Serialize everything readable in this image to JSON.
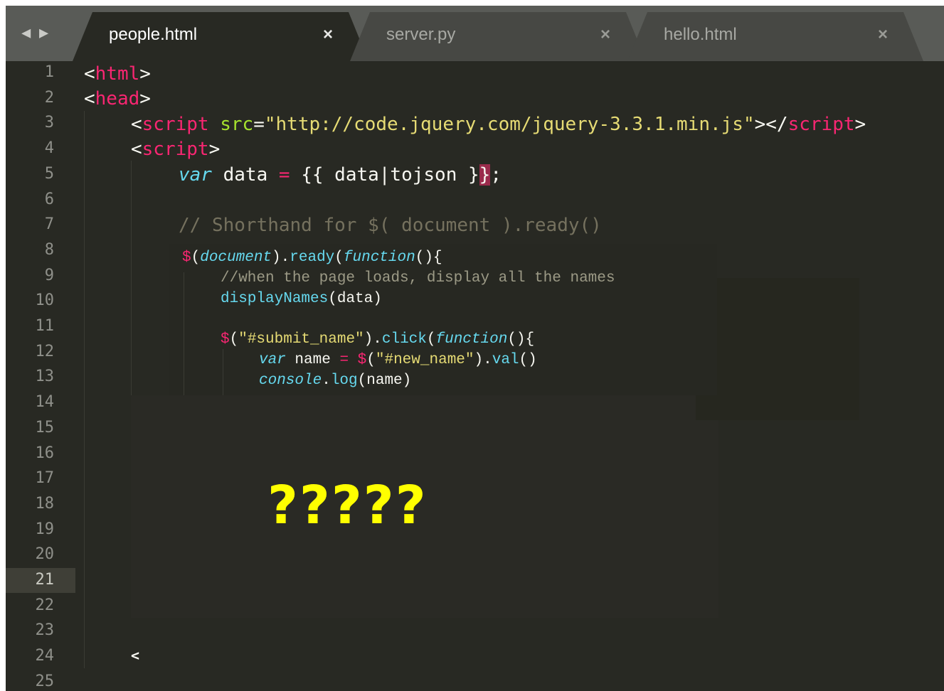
{
  "nav": {
    "back_arrow": "◀",
    "forward_arrow": "▶"
  },
  "tabs": [
    {
      "label": "people.html",
      "close": "×",
      "active": true
    },
    {
      "label": "server.py",
      "close": "×",
      "active": false
    },
    {
      "label": "hello.html",
      "close": "×",
      "active": false
    }
  ],
  "gutter": {
    "line_numbers": [
      "1",
      "2",
      "3",
      "4",
      "5",
      "6",
      "7",
      "8",
      "9",
      "10",
      "11",
      "12",
      "13",
      "14",
      "15",
      "16",
      "17",
      "18",
      "19",
      "20",
      "21",
      "22",
      "23",
      "24",
      "25"
    ],
    "current_line": "21"
  },
  "code": {
    "l1_open": "<",
    "l1_tag": "html",
    "l1_close": ">",
    "l2_open": "<",
    "l2_tag": "head",
    "l2_close": ">",
    "l3_open": "<",
    "l3_tag": "script",
    "l3_attr": "src",
    "l3_eq": "=",
    "l3_str": "\"http://code.jquery.com/jquery-3.3.1.min.js\"",
    "l3_mid": "></",
    "l3_tag2": "script",
    "l3_end": ">",
    "l4_open": "<",
    "l4_tag": "script",
    "l4_close": ">",
    "l5_kw": "var",
    "l5_a": " data ",
    "l5_eq": "=",
    "l5_b": " {{ data|tojson }",
    "l5_hl": "}",
    "l5_semi": ";",
    "l7_comment": "// Shorthand for $( document ).ready()",
    "l24_text": "<"
  },
  "overlay_code": {
    "o1_dollar": "$",
    "o1_p1": "(",
    "o1_doc": "document",
    "o1_p2": ").",
    "o1_ready": "ready",
    "o1_p3": "(",
    "o1_fn": "function",
    "o1_p4": "(){",
    "o2_comment": "//when the page loads, display all the names",
    "o3_call": "displayNames",
    "o3_args": "(data)",
    "o4_dollar": "$",
    "o4_p1": "(",
    "o4_str": "\"#submit_name\"",
    "o4_p2": ").",
    "o4_click": "click",
    "o4_p3": "(",
    "o4_fn": "function",
    "o4_p4": "(){",
    "o5_var": "var",
    "o5_a": " name ",
    "o5_eq": "=",
    "o5_sp": " ",
    "o5_dollar": "$",
    "o5_p1": "(",
    "o5_str": "\"#new_name\"",
    "o5_p2": ").",
    "o5_val": "val",
    "o5_p3": "()",
    "o6_console": "console",
    "o6_dot": ".",
    "o6_log": "log",
    "o6_args": "(name)"
  },
  "annotation": "?????",
  "colors": {
    "editor_bg": "#282923",
    "tag": "#f92672",
    "attr": "#a6e22e",
    "string": "#e6db74",
    "keyword": "#66d9ef",
    "comment": "#75715e",
    "annotation": "#ffff00"
  }
}
